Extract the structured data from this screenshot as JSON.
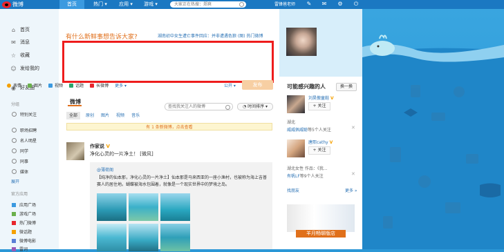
{
  "topbar": {
    "logo_text": "微博",
    "nav": [
      "首页",
      "热门 ▾",
      "应用 ▾",
      "游戏 ▾"
    ],
    "search_placeholder": "大家正在热搜：郑爽",
    "user_name": "雷锋爸老师"
  },
  "leftnav": {
    "items": [
      "首页",
      "消息",
      "收藏",
      "发给我的"
    ],
    "friends_circle": "好友圈",
    "group_title": "分组",
    "special": "特别关注",
    "groups": [
      "职场招聘",
      "名人明星",
      "同学",
      "同事",
      "媒体"
    ],
    "expand": "展开",
    "apps_title": "官方应用",
    "apps": [
      "应用广场",
      "游戏广场",
      "热门微博",
      "微话题",
      "微博电影",
      "雷词"
    ]
  },
  "composer": {
    "prompt": "有什么新鲜事想告诉大家?",
    "related": "湖南初中女生遭亡事件回应：并非遭遇色狼 (图)   热门微博",
    "tools": [
      "表情",
      "图片",
      "视频",
      "话题",
      "长微博",
      "更多 ▾"
    ],
    "visibility": "公开 ▾",
    "publish": "发布"
  },
  "feed": {
    "title": "微博",
    "search_placeholder": "查找我关注人的微博",
    "sort": "◔ 时间排序 ▾",
    "tabs": [
      "全部",
      "原创",
      "图片",
      "视频",
      "音乐"
    ],
    "new_notice": "有 1 条新微博，点击查看",
    "post": {
      "author": "作家说",
      "author_badge": "V",
      "text": "净化心灵的一片净土！  [微风]",
      "repost_author": "@薄荷阁",
      "repost_text": "【纯净的仙本那，净化心灵的一片净土】仙本那是马来西亚的一座小渔村，也被称为海上吉普赛人的居住地。蝴蝶被海水包围着，就像是一个现实世界中的梦境之岛。"
    }
  },
  "right": {
    "title": "可能感兴趣的人",
    "refresh": "换一换",
    "people": [
      {
        "name": "刘昊傲童鞋",
        "badge": "V",
        "follow": "+ 关注",
        "line1": "湖北",
        "line2_link": "威威佩威聪",
        "line2": "等5个人关注"
      },
      {
        "name": "唐熙cathy",
        "badge": "V",
        "follow": "+ 关注",
        "line1": "湖北女性 作品：《我...",
        "line2_link": "有帆LF",
        "line2": "等9个人关注"
      }
    ],
    "find_friends": "找朋友",
    "more": "更多 »",
    "ad_text": "羊月畅聊版店"
  },
  "colors": {
    "topbar": "#1b78c2",
    "accent": "#e06f1b",
    "highlight_box": "#ee1c1c",
    "link": "#2a72b5"
  }
}
